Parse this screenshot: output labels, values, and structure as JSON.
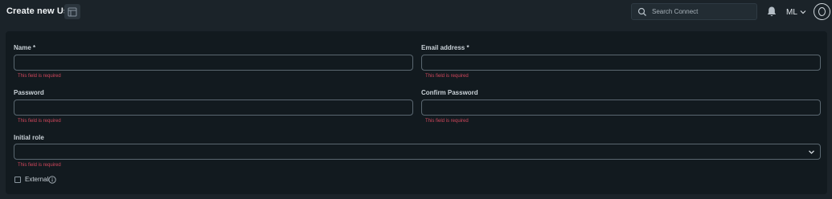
{
  "header": {
    "title": "Create new User",
    "search_placeholder": "Search Connect",
    "user_initials": "ML"
  },
  "form": {
    "name_label": "Name *",
    "email_label": "Email address *",
    "password_label": "Password",
    "confirm_password_label": "Confirm Password",
    "initial_role_label": "Initial role",
    "external_label": "External",
    "error_required": "This field is required",
    "name_value": "",
    "email_value": "",
    "password_value": "",
    "confirm_password_value": "",
    "initial_role_value": ""
  },
  "colors": {
    "background": "#1b2329",
    "card": "#121a1f",
    "field_border": "#5a6770",
    "error": "#d0465b"
  },
  "icons": {
    "title_action": "window-icon",
    "search": "search-icon",
    "notifications": "bell-icon",
    "user_menu": "chevron-down-icon",
    "avatar": "user-avatar-icon",
    "select": "chevron-down-icon",
    "info": "info-icon"
  }
}
